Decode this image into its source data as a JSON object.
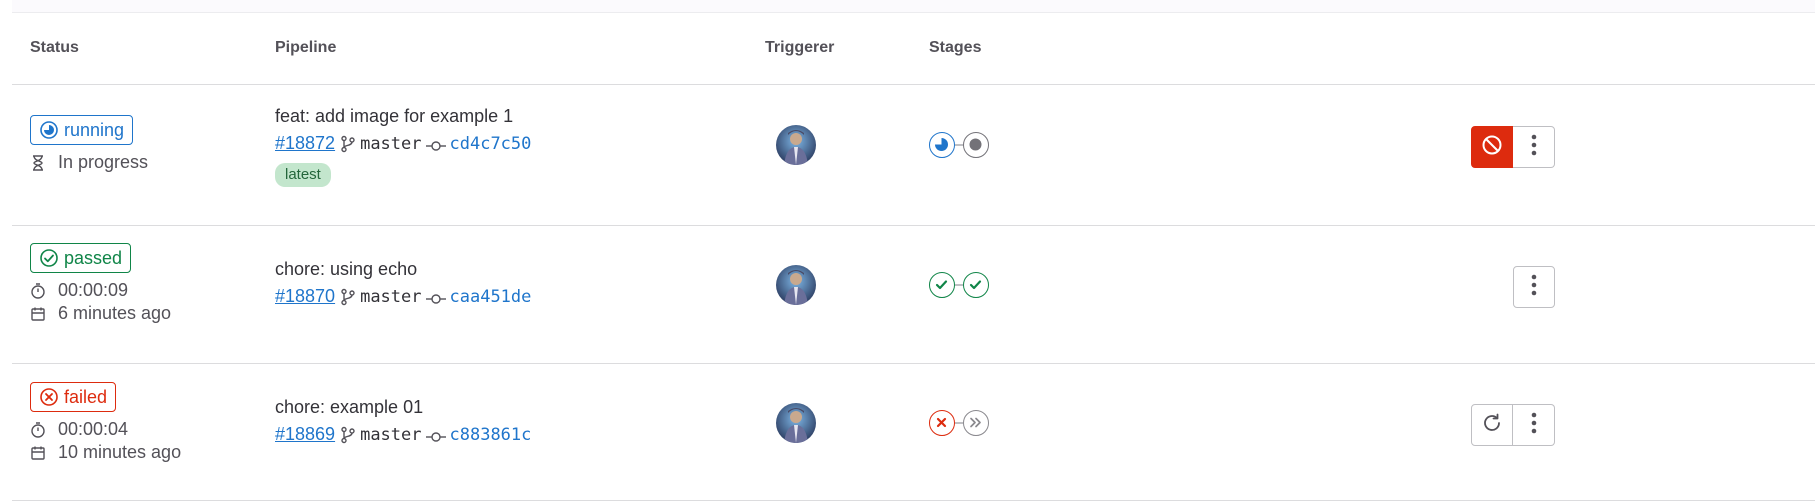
{
  "table": {
    "headers": {
      "status": "Status",
      "pipeline": "Pipeline",
      "triggerer": "Triggerer",
      "stages": "Stages"
    }
  },
  "rows": [
    {
      "status": {
        "label": "running",
        "kind": "running",
        "color": "#1f75cb"
      },
      "meta": [
        {
          "icon": "hourglass-icon",
          "text": "In progress"
        }
      ],
      "commit_title": "feat: add image for example 1",
      "pipeline_id": "#18872",
      "branch": "master",
      "sha": "cd4c7c50",
      "badge": "latest",
      "stages": [
        "running",
        "created"
      ],
      "actions": [
        "cancel",
        "more"
      ]
    },
    {
      "status": {
        "label": "passed",
        "kind": "passed",
        "color": "#108548"
      },
      "meta": [
        {
          "icon": "timer-icon",
          "text": "00:00:09"
        },
        {
          "icon": "calendar-icon",
          "text": "6 minutes ago"
        }
      ],
      "commit_title": "chore: using echo",
      "pipeline_id": "#18870",
      "branch": "master",
      "sha": "caa451de",
      "stages": [
        "success",
        "success"
      ],
      "actions": [
        "more"
      ]
    },
    {
      "status": {
        "label": "failed",
        "kind": "failed",
        "color": "#dd2b0e"
      },
      "meta": [
        {
          "icon": "timer-icon",
          "text": "00:00:04"
        },
        {
          "icon": "calendar-icon",
          "text": "10 minutes ago"
        }
      ],
      "commit_title": "chore: example 01",
      "pipeline_id": "#18869",
      "branch": "master",
      "sha": "c883861c",
      "stages": [
        "failed",
        "skipped"
      ],
      "actions": [
        "retry",
        "more"
      ]
    }
  ]
}
